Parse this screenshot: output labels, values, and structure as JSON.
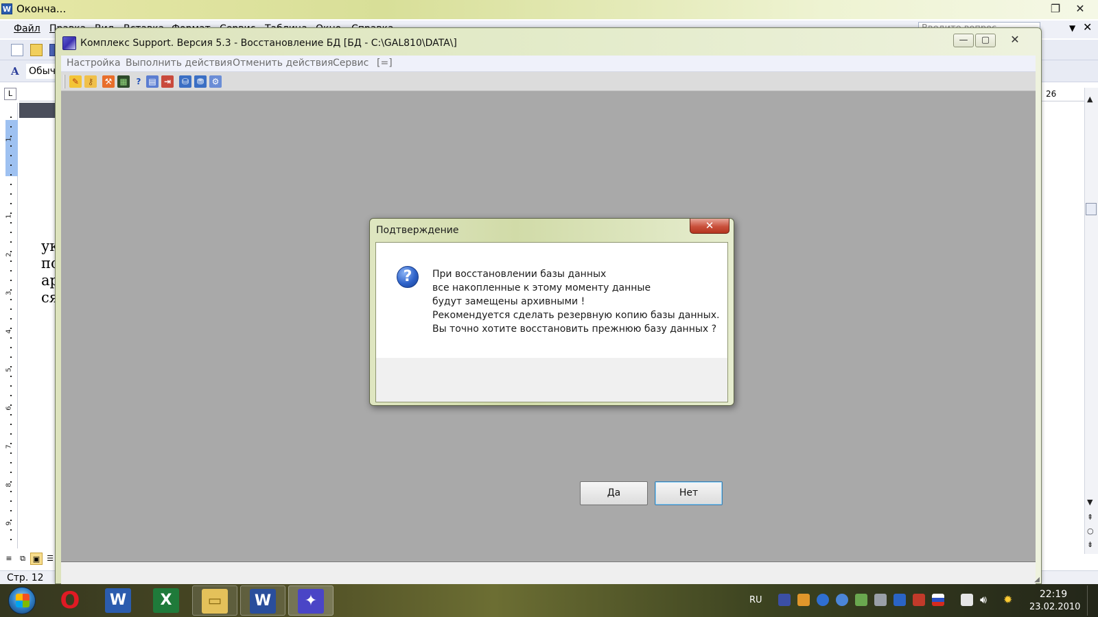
{
  "word": {
    "title": "Оконча...",
    "menu": [
      "Файл",
      "Правка",
      "Вид",
      "Вставка",
      "Формат",
      "Сервис",
      "Таблица",
      "Окно",
      "Справка"
    ],
    "ask_placeholder": "Введите вопрос",
    "style_value": "Обыч",
    "ruler_number": "26",
    "status_page": "Стр. 12",
    "page_text_lines": [
      "ук",
      "по",
      "ар",
      "ся"
    ],
    "vruler_marks": [
      "1",
      "1",
      "2",
      "3",
      "4",
      "5",
      "6",
      "7",
      "8",
      "9"
    ]
  },
  "app": {
    "title": "Комплекс Support. Версия 5.3 - Восстановление БД [БД - C:\\GAL810\\DATA\\]",
    "menu": [
      "Настройка",
      "Выполнить действия",
      "Отменить действия",
      "Сервис",
      "[=]"
    ],
    "caption": {
      "minimize": "—",
      "maximize": "▢",
      "close": "✕"
    }
  },
  "dialog": {
    "title": "Подтверждение",
    "close_glyph": "✕",
    "icon_glyph": "?",
    "message_lines": [
      "При восстановлении базы данных",
      "все накопленные к этому моменту данные",
      "будут замещены архивными !",
      "Рекомендуется сделать резервную копию базы данных.",
      "Вы точно хотите восстановить прежнюю базу данных ?"
    ],
    "yes_label": "Да",
    "no_label": "Нет"
  },
  "taskbar": {
    "lang": "RU",
    "time": "22:19",
    "date": "23.02.2010",
    "apps": [
      {
        "name": "opera",
        "glyph": "O",
        "color": "#d9141d"
      },
      {
        "name": "word",
        "glyph": "W",
        "color": "#2b5cae"
      },
      {
        "name": "excel",
        "glyph": "X",
        "color": "#1f7a3a"
      },
      {
        "name": "explorer",
        "glyph": "▭",
        "color": "#e4c15a"
      },
      {
        "name": "word-doc",
        "glyph": "W",
        "color": "#2a4e9c"
      },
      {
        "name": "support",
        "glyph": "✦",
        "color": "#4a45c6"
      }
    ]
  },
  "colors": {
    "dialog_close": "#c9503b",
    "app_client": "#a9a9a9",
    "accent_blue": "#2f63c9"
  }
}
